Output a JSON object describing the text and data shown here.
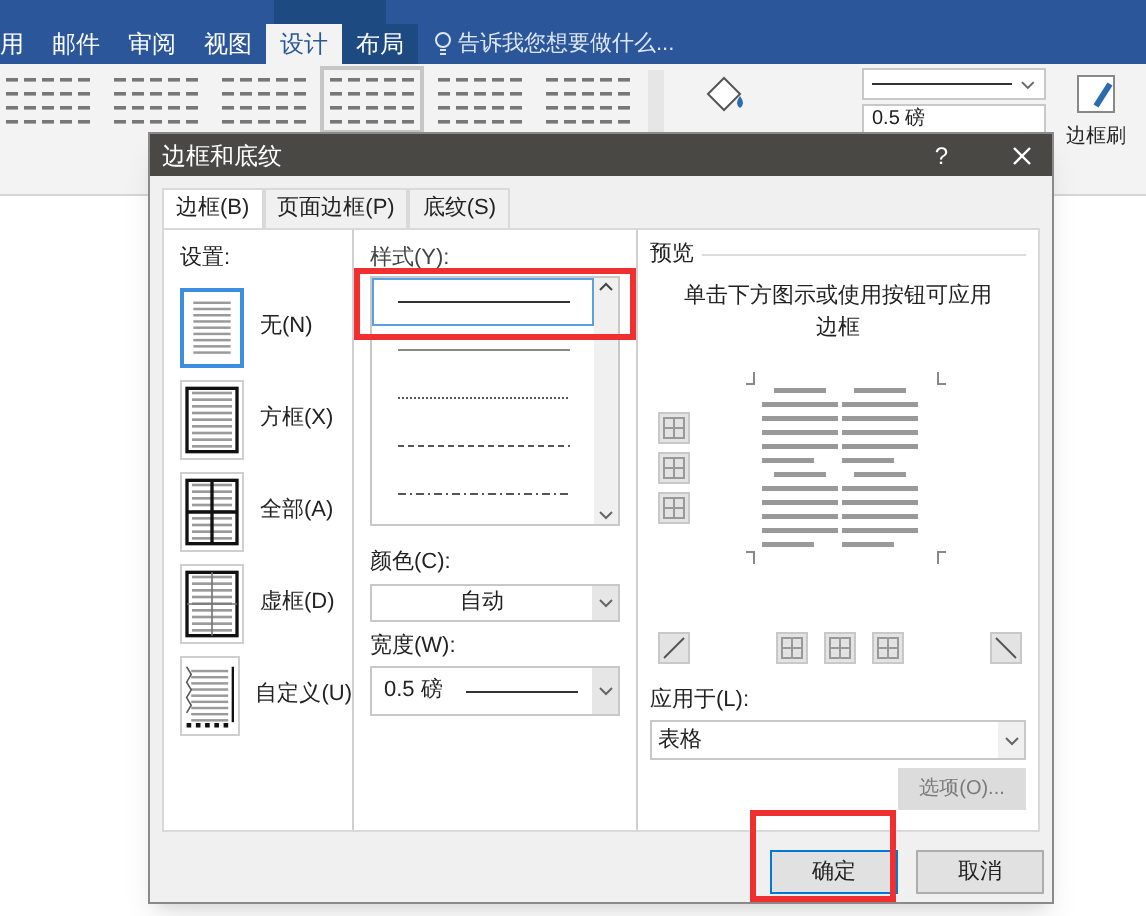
{
  "word": {
    "ribbon_tabs": [
      {
        "label": "用",
        "selected": false,
        "context": false
      },
      {
        "label": "邮件",
        "selected": false,
        "context": false
      },
      {
        "label": "审阅",
        "selected": false,
        "context": false
      },
      {
        "label": "视图",
        "selected": false,
        "context": false
      },
      {
        "label": "设计",
        "selected": true,
        "context": true
      },
      {
        "label": "布局",
        "selected": false,
        "context": true
      }
    ],
    "tell_me": "告诉我您想要做什么...",
    "line_weight": "0.5 磅",
    "format_painter": "边框刷"
  },
  "dialog": {
    "title": "边框和底纹",
    "help": "?",
    "tabs": [
      {
        "label": "边框(B)",
        "selected": true
      },
      {
        "label": "页面边框(P)",
        "selected": false
      },
      {
        "label": "底纹(S)",
        "selected": false
      }
    ],
    "settings_label": "设置:",
    "settings": [
      {
        "label": "无(N)",
        "kind": "none",
        "selected": true
      },
      {
        "label": "方框(X)",
        "kind": "box",
        "selected": false
      },
      {
        "label": "全部(A)",
        "kind": "all",
        "selected": false
      },
      {
        "label": "虚框(D)",
        "kind": "grid",
        "selected": false
      },
      {
        "label": "自定义(U)",
        "kind": "custom",
        "selected": false
      }
    ],
    "style_label": "样式(Y):",
    "styles": [
      {
        "kind": "solid",
        "selected": true
      },
      {
        "kind": "thin",
        "selected": false
      },
      {
        "kind": "dotted",
        "selected": false
      },
      {
        "kind": "dashed",
        "selected": false
      },
      {
        "kind": "dashdot",
        "selected": false
      }
    ],
    "color_label": "颜色(C):",
    "color_value": "自动",
    "width_label": "宽度(W):",
    "width_value": "0.5 磅",
    "preview_label": "预览",
    "preview_hint": "单击下方图示或使用按钮可应用边框",
    "apply_label": "应用于(L):",
    "apply_value": "表格",
    "options_button": {
      "label": "选项(O)...",
      "disabled": true
    },
    "ok": "确定",
    "cancel": "取消"
  }
}
